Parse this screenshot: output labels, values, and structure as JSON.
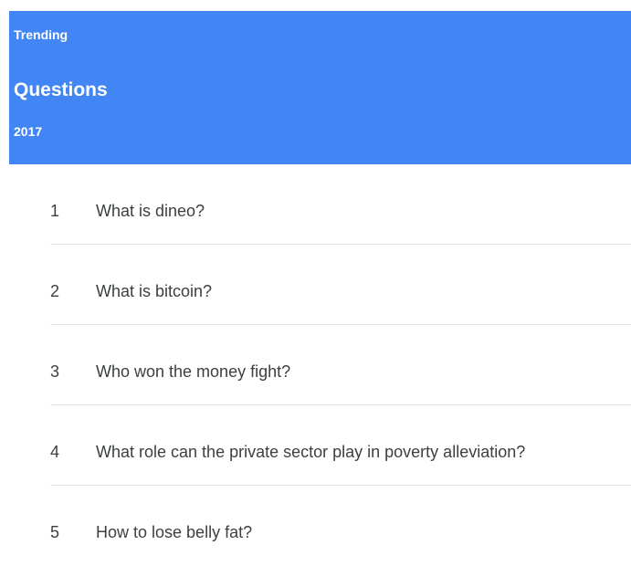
{
  "header": {
    "kicker": "Trending",
    "title": "Questions",
    "year": "2017",
    "background_color": "#4285f4"
  },
  "questions": [
    {
      "rank": "1",
      "text": "What is dineo?"
    },
    {
      "rank": "2",
      "text": "What is bitcoin?"
    },
    {
      "rank": "3",
      "text": "Who won the money fight?"
    },
    {
      "rank": "4",
      "text": "What role can the private sector play in poverty alleviation?"
    },
    {
      "rank": "5",
      "text": "How to lose belly fat?"
    }
  ]
}
